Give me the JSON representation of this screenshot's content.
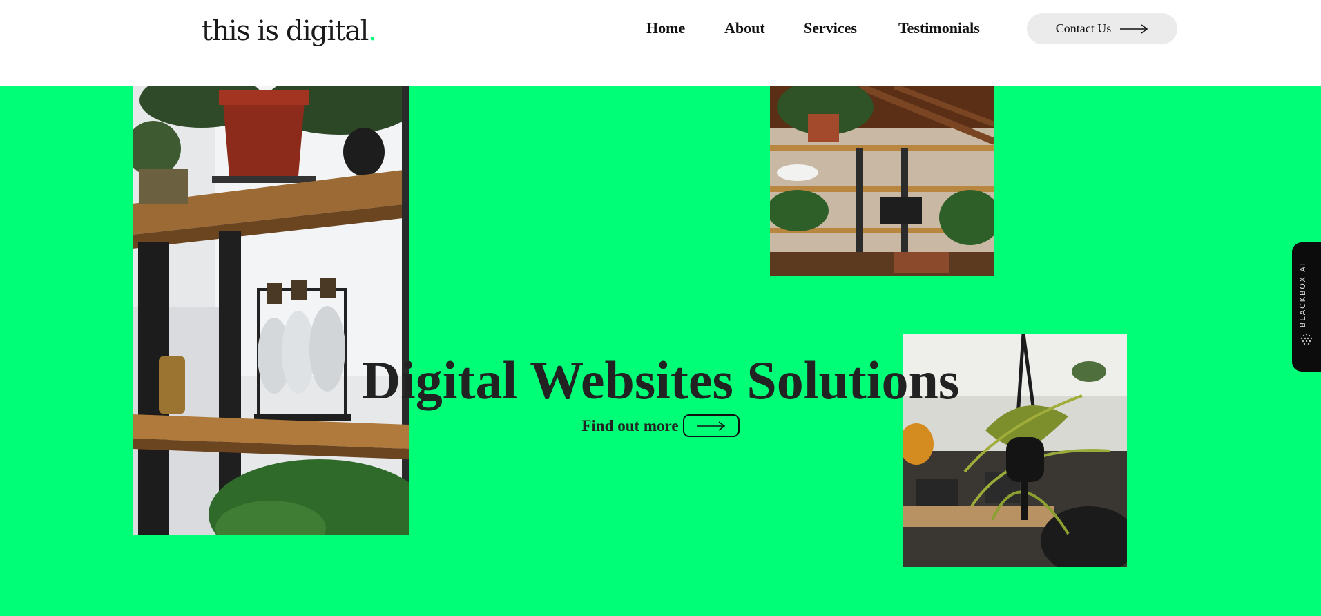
{
  "header": {
    "logo_text": "this is digital",
    "logo_dot": ".",
    "nav": [
      {
        "label": "Home"
      },
      {
        "label": "About"
      },
      {
        "label": "Services"
      },
      {
        "label": "Testimonials"
      }
    ],
    "contact_label": "Contact Us"
  },
  "hero": {
    "title": "Digital Websites Solutions",
    "cta_label": "Find out more",
    "background": "#00ff77"
  },
  "side_widget": {
    "label": "BLACKBOX AI"
  },
  "colors": {
    "accent": "#00ff77",
    "text": "#222222"
  }
}
